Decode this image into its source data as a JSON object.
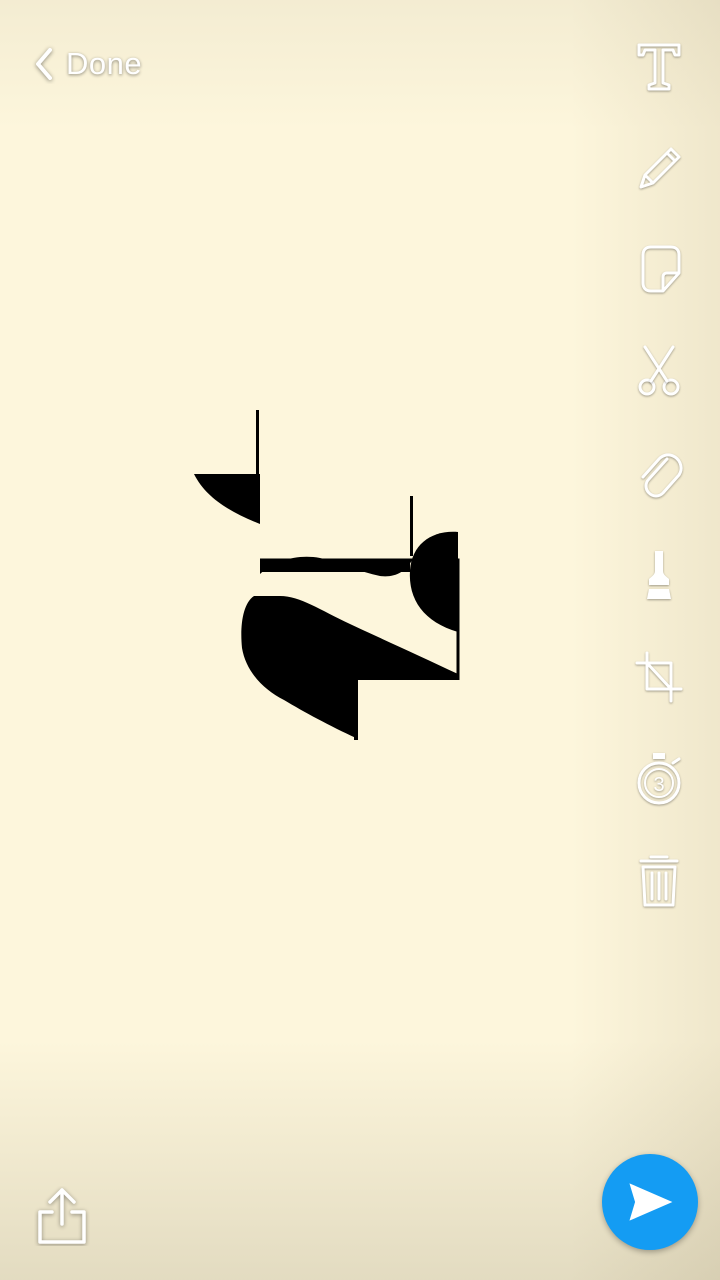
{
  "header": {
    "done_label": "Done",
    "back_icon": "chevron-left-icon"
  },
  "toolbar": {
    "tools": [
      {
        "name": "text-tool",
        "icon": "text-t-icon",
        "label": "T"
      },
      {
        "name": "pencil-tool",
        "icon": "pencil-icon"
      },
      {
        "name": "sticker-tool",
        "icon": "sticker-icon"
      },
      {
        "name": "scissors-tool",
        "icon": "scissors-icon"
      },
      {
        "name": "attach-tool",
        "icon": "paperclip-icon"
      },
      {
        "name": "paintbrush-tool",
        "icon": "paintbrush-icon"
      },
      {
        "name": "crop-tool",
        "icon": "crop-icon"
      },
      {
        "name": "timer-tool",
        "icon": "stopwatch-icon",
        "label": "3"
      },
      {
        "name": "delete-tool",
        "icon": "trash-icon"
      }
    ]
  },
  "footer": {
    "share_icon": "share-export-icon",
    "send_icon": "send-arrow-icon",
    "send_color": "#149cf3"
  },
  "canvas": {
    "background": "#fdf6dc"
  }
}
